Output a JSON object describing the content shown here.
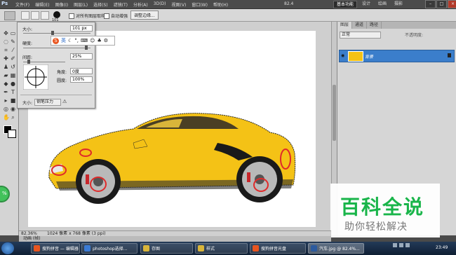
{
  "menubar": {
    "app_logo": "Ps",
    "menus": [
      "文件(F)",
      "编辑(E)",
      "图像(I)",
      "图层(L)",
      "选择(S)",
      "滤镜(T)",
      "分析(A)",
      "3D(D)",
      "视图(V)",
      "窗口(W)",
      "帮助(H)"
    ],
    "zoom": "82.4",
    "workspaces": [
      "基本功能",
      "设计",
      "绘画",
      "摄影"
    ],
    "active_workspace": "基本功能"
  },
  "options": {
    "brush_size_label": "101",
    "sample_all_layers": "对所有图层取样",
    "auto_enhance": "自动增强",
    "refine_edge": "调整边缘..."
  },
  "brush_popup": {
    "size_label": "大小:",
    "size_value": "101 px",
    "hardness_label": "硬度:",
    "spacing_label": "间距:",
    "spacing_value": "25%",
    "angle_label": "角度:",
    "angle_value": "0度",
    "roundness_label": "圆度:",
    "roundness_value": "100%",
    "size_control_label": "大小:",
    "size_control_value": "钢笔压力",
    "ime_text": "英"
  },
  "layers_panel": {
    "tabs": [
      "图层",
      "通道",
      "路径"
    ],
    "active_tab": "图层",
    "blend_mode": "正常",
    "opacity_label": "不透明度:",
    "layer_name": "背景"
  },
  "status": {
    "zoom": "82.36%",
    "doc_info": "1024 像素 x 768 像素 (3 ppi)",
    "line": "动画 (帧)"
  },
  "watermark": {
    "title": "百科全说",
    "subtitle": "助你轻松解决"
  },
  "taskbar": {
    "tasks": [
      "搜狗拼音 — 编辑器",
      "photoshop选择...",
      "存图",
      "样式",
      "搜狗拼音光盘",
      "汽车.jpg @ 82.4%..."
    ],
    "clock": "23:49"
  },
  "colors": {
    "accent": "#3b7ecb",
    "car_yellow": "#f4c216",
    "selection_marker": "#e02a2a",
    "watermark_green": "#19b54a"
  }
}
